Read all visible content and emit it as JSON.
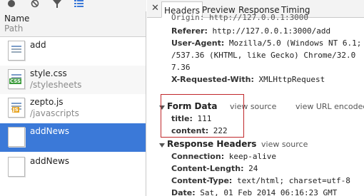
{
  "toolbar": {
    "icons": [
      "record-icon",
      "clear-icon",
      "filter-icon",
      "list-view-icon"
    ]
  },
  "columns": {
    "name": "Name",
    "path": "Path"
  },
  "requests": [
    {
      "name": "add",
      "path": "",
      "icon": "document-icon"
    },
    {
      "name": "style.css",
      "path": "/stylesheets",
      "icon": "css-file-icon"
    },
    {
      "name": "zepto.js",
      "path": "/javascripts",
      "icon": "js-file-icon"
    },
    {
      "name": "addNews",
      "path": "",
      "icon": "document-icon",
      "selected": true
    },
    {
      "name": "addNews",
      "path": "",
      "icon": "document-icon"
    }
  ],
  "tabs": [
    "Headers",
    "Preview",
    "Response",
    "Timing"
  ],
  "active_tab": "Headers",
  "request_headers": {
    "origin": "Origin: http://127.0.0.1:3000",
    "referer_key": "Referer:",
    "referer_val": "http://127.0.0.1:3000/add",
    "ua_key": "User-Agent:",
    "ua_line1": "Mozilla/5.0 (Windows NT 6.1;",
    "ua_line2": "/537.36 (KHTML, like Gecko) Chrome/32.0",
    "ua_line3": "7.36",
    "xrw_key": "X-Requested-With:",
    "xrw_val": "XMLHttpRequest"
  },
  "form_data": {
    "title": "Form Data",
    "view_source": "view source",
    "view_url_encoded": "view URL encoded",
    "fields": [
      {
        "key": "title:",
        "value": "111"
      },
      {
        "key": "content:",
        "value": "222"
      }
    ]
  },
  "response_headers": {
    "title": "Response Headers",
    "view_source": "view source",
    "items": [
      {
        "key": "Connection:",
        "value": "keep-alive"
      },
      {
        "key": "Content-Length:",
        "value": "24"
      },
      {
        "key": "Content-Type:",
        "value": "text/html; charset=utf-8"
      },
      {
        "key": "Date:",
        "value": "Sat, 01 Feb 2014 06:16:23 GMT"
      }
    ]
  },
  "colors": {
    "selected_row": "#3b79d8",
    "highlight_border": "#c0282b"
  }
}
